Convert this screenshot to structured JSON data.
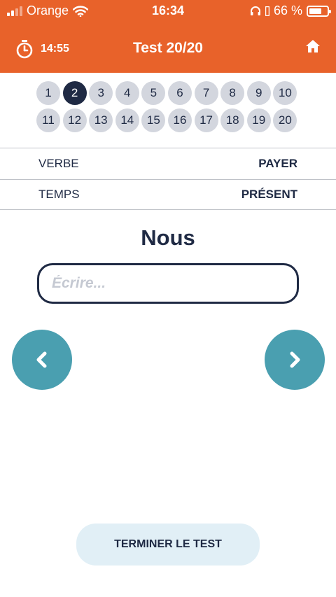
{
  "status_bar": {
    "carrier": "Orange",
    "time": "16:34",
    "battery": "66 %"
  },
  "header": {
    "timer": "14:55",
    "title": "Test 20/20",
    "home_icon": "home-icon",
    "timer_icon": "stopwatch-icon"
  },
  "questions": {
    "active": "2",
    "items": [
      "1",
      "2",
      "3",
      "4",
      "5",
      "6",
      "7",
      "8",
      "9",
      "10",
      "11",
      "12",
      "13",
      "14",
      "15",
      "16",
      "17",
      "18",
      "19",
      "20"
    ]
  },
  "info": {
    "verb_label": "VERBE",
    "verb_value": "PAYER",
    "tense_label": "TEMPS",
    "tense_value": "PRÉSENT"
  },
  "exercise": {
    "pronoun": "Nous",
    "placeholder": "Écrire...",
    "value": ""
  },
  "navigation": {
    "prev_icon": "chevron-left-icon",
    "next_icon": "chevron-right-icon"
  },
  "footer": {
    "finish_label": "TERMINER LE TEST"
  },
  "colors": {
    "header": "#e8622a",
    "navy": "#1f2a44",
    "teal": "#4a9fb0",
    "pill": "#d3d6de",
    "finish_bg": "#e1eff6"
  }
}
